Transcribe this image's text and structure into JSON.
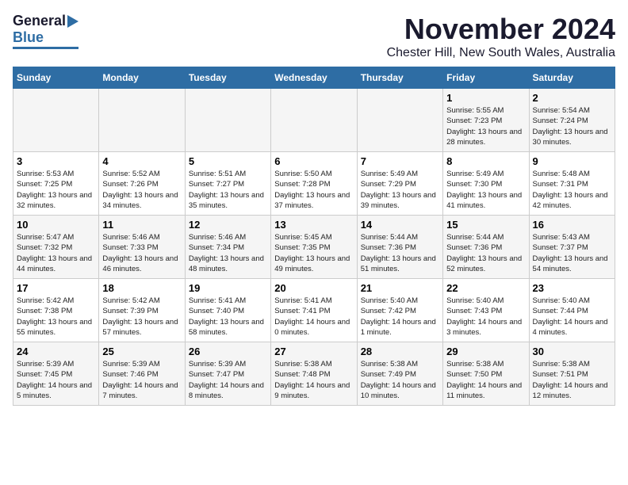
{
  "header": {
    "logo_general": "General",
    "logo_blue": "Blue",
    "month_title": "November 2024",
    "location": "Chester Hill, New South Wales, Australia"
  },
  "weekdays": [
    "Sunday",
    "Monday",
    "Tuesday",
    "Wednesday",
    "Thursday",
    "Friday",
    "Saturday"
  ],
  "weeks": [
    [
      {
        "day": "",
        "sunrise": "",
        "sunset": "",
        "daylight": ""
      },
      {
        "day": "",
        "sunrise": "",
        "sunset": "",
        "daylight": ""
      },
      {
        "day": "",
        "sunrise": "",
        "sunset": "",
        "daylight": ""
      },
      {
        "day": "",
        "sunrise": "",
        "sunset": "",
        "daylight": ""
      },
      {
        "day": "",
        "sunrise": "",
        "sunset": "",
        "daylight": ""
      },
      {
        "day": "1",
        "sunrise": "Sunrise: 5:55 AM",
        "sunset": "Sunset: 7:23 PM",
        "daylight": "Daylight: 13 hours and 28 minutes."
      },
      {
        "day": "2",
        "sunrise": "Sunrise: 5:54 AM",
        "sunset": "Sunset: 7:24 PM",
        "daylight": "Daylight: 13 hours and 30 minutes."
      }
    ],
    [
      {
        "day": "3",
        "sunrise": "Sunrise: 5:53 AM",
        "sunset": "Sunset: 7:25 PM",
        "daylight": "Daylight: 13 hours and 32 minutes."
      },
      {
        "day": "4",
        "sunrise": "Sunrise: 5:52 AM",
        "sunset": "Sunset: 7:26 PM",
        "daylight": "Daylight: 13 hours and 34 minutes."
      },
      {
        "day": "5",
        "sunrise": "Sunrise: 5:51 AM",
        "sunset": "Sunset: 7:27 PM",
        "daylight": "Daylight: 13 hours and 35 minutes."
      },
      {
        "day": "6",
        "sunrise": "Sunrise: 5:50 AM",
        "sunset": "Sunset: 7:28 PM",
        "daylight": "Daylight: 13 hours and 37 minutes."
      },
      {
        "day": "7",
        "sunrise": "Sunrise: 5:49 AM",
        "sunset": "Sunset: 7:29 PM",
        "daylight": "Daylight: 13 hours and 39 minutes."
      },
      {
        "day": "8",
        "sunrise": "Sunrise: 5:49 AM",
        "sunset": "Sunset: 7:30 PM",
        "daylight": "Daylight: 13 hours and 41 minutes."
      },
      {
        "day": "9",
        "sunrise": "Sunrise: 5:48 AM",
        "sunset": "Sunset: 7:31 PM",
        "daylight": "Daylight: 13 hours and 42 minutes."
      }
    ],
    [
      {
        "day": "10",
        "sunrise": "Sunrise: 5:47 AM",
        "sunset": "Sunset: 7:32 PM",
        "daylight": "Daylight: 13 hours and 44 minutes."
      },
      {
        "day": "11",
        "sunrise": "Sunrise: 5:46 AM",
        "sunset": "Sunset: 7:33 PM",
        "daylight": "Daylight: 13 hours and 46 minutes."
      },
      {
        "day": "12",
        "sunrise": "Sunrise: 5:46 AM",
        "sunset": "Sunset: 7:34 PM",
        "daylight": "Daylight: 13 hours and 48 minutes."
      },
      {
        "day": "13",
        "sunrise": "Sunrise: 5:45 AM",
        "sunset": "Sunset: 7:35 PM",
        "daylight": "Daylight: 13 hours and 49 minutes."
      },
      {
        "day": "14",
        "sunrise": "Sunrise: 5:44 AM",
        "sunset": "Sunset: 7:36 PM",
        "daylight": "Daylight: 13 hours and 51 minutes."
      },
      {
        "day": "15",
        "sunrise": "Sunrise: 5:44 AM",
        "sunset": "Sunset: 7:36 PM",
        "daylight": "Daylight: 13 hours and 52 minutes."
      },
      {
        "day": "16",
        "sunrise": "Sunrise: 5:43 AM",
        "sunset": "Sunset: 7:37 PM",
        "daylight": "Daylight: 13 hours and 54 minutes."
      }
    ],
    [
      {
        "day": "17",
        "sunrise": "Sunrise: 5:42 AM",
        "sunset": "Sunset: 7:38 PM",
        "daylight": "Daylight: 13 hours and 55 minutes."
      },
      {
        "day": "18",
        "sunrise": "Sunrise: 5:42 AM",
        "sunset": "Sunset: 7:39 PM",
        "daylight": "Daylight: 13 hours and 57 minutes."
      },
      {
        "day": "19",
        "sunrise": "Sunrise: 5:41 AM",
        "sunset": "Sunset: 7:40 PM",
        "daylight": "Daylight: 13 hours and 58 minutes."
      },
      {
        "day": "20",
        "sunrise": "Sunrise: 5:41 AM",
        "sunset": "Sunset: 7:41 PM",
        "daylight": "Daylight: 14 hours and 0 minutes."
      },
      {
        "day": "21",
        "sunrise": "Sunrise: 5:40 AM",
        "sunset": "Sunset: 7:42 PM",
        "daylight": "Daylight: 14 hours and 1 minute."
      },
      {
        "day": "22",
        "sunrise": "Sunrise: 5:40 AM",
        "sunset": "Sunset: 7:43 PM",
        "daylight": "Daylight: 14 hours and 3 minutes."
      },
      {
        "day": "23",
        "sunrise": "Sunrise: 5:40 AM",
        "sunset": "Sunset: 7:44 PM",
        "daylight": "Daylight: 14 hours and 4 minutes."
      }
    ],
    [
      {
        "day": "24",
        "sunrise": "Sunrise: 5:39 AM",
        "sunset": "Sunset: 7:45 PM",
        "daylight": "Daylight: 14 hours and 5 minutes."
      },
      {
        "day": "25",
        "sunrise": "Sunrise: 5:39 AM",
        "sunset": "Sunset: 7:46 PM",
        "daylight": "Daylight: 14 hours and 7 minutes."
      },
      {
        "day": "26",
        "sunrise": "Sunrise: 5:39 AM",
        "sunset": "Sunset: 7:47 PM",
        "daylight": "Daylight: 14 hours and 8 minutes."
      },
      {
        "day": "27",
        "sunrise": "Sunrise: 5:38 AM",
        "sunset": "Sunset: 7:48 PM",
        "daylight": "Daylight: 14 hours and 9 minutes."
      },
      {
        "day": "28",
        "sunrise": "Sunrise: 5:38 AM",
        "sunset": "Sunset: 7:49 PM",
        "daylight": "Daylight: 14 hours and 10 minutes."
      },
      {
        "day": "29",
        "sunrise": "Sunrise: 5:38 AM",
        "sunset": "Sunset: 7:50 PM",
        "daylight": "Daylight: 14 hours and 11 minutes."
      },
      {
        "day": "30",
        "sunrise": "Sunrise: 5:38 AM",
        "sunset": "Sunset: 7:51 PM",
        "daylight": "Daylight: 14 hours and 12 minutes."
      }
    ]
  ]
}
